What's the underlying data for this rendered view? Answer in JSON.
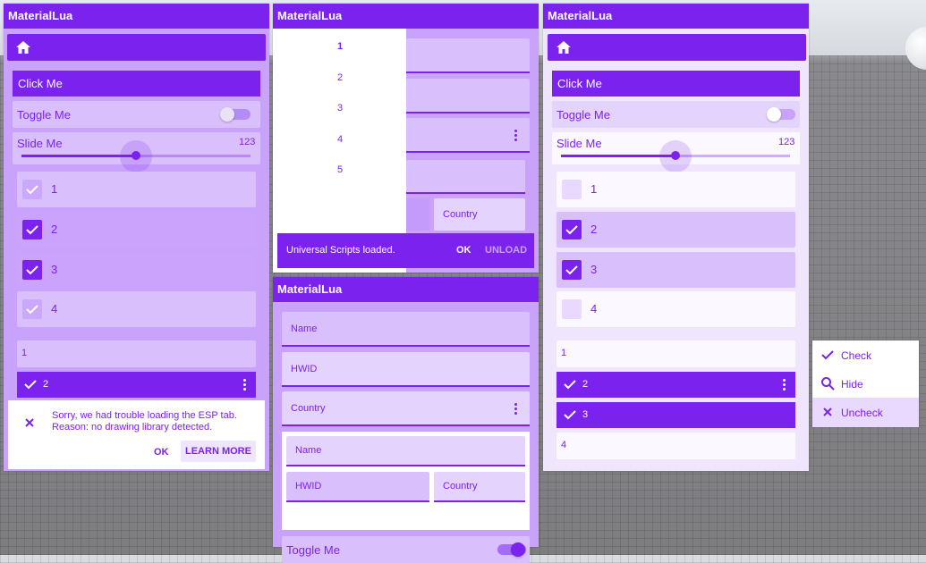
{
  "app": {
    "title": "MaterialLua"
  },
  "colors": {
    "accent": "#7b22ee",
    "panel": "#c9a2fb",
    "panel_light": "#efe6fd"
  },
  "win_left": {
    "title": "MaterialLua",
    "nav_icon": "home-icon",
    "button_label": "Click Me",
    "toggle_label": "Toggle Me",
    "slider_label": "Slide Me",
    "slider_value": "123",
    "checkboxes": [
      {
        "label": "1",
        "checked": true
      },
      {
        "label": "2",
        "checked": true
      },
      {
        "label": "3",
        "checked": true
      },
      {
        "label": "4",
        "checked": true
      }
    ],
    "list": [
      {
        "label": "1"
      },
      {
        "label": "2"
      }
    ],
    "dialog": {
      "message": "Sorry, we had trouble loading the ESP tab. Reason: no drawing library detected.",
      "ok_label": "OK",
      "learn_more_label": "LEARN MORE",
      "icon": "close-icon"
    }
  },
  "win_mid_top": {
    "title": "MaterialLua",
    "page_numbers": [
      "1",
      "2",
      "3",
      "4",
      "5"
    ],
    "country_label": "Country",
    "snackbar": {
      "message": "Universal Scripts loaded.",
      "ok_label": "OK",
      "unload_label": "UNLOAD"
    }
  },
  "win_mid_bottom": {
    "title": "MaterialLua",
    "fields": [
      {
        "label": "Name"
      },
      {
        "label": "HWID"
      },
      {
        "label": "Country"
      }
    ],
    "grid": {
      "name": "Name",
      "hwid": "HWID",
      "country": "Country"
    },
    "toggle_label": "Toggle Me"
  },
  "win_right": {
    "title": "MaterialLua",
    "nav_icon": "home-icon",
    "button_label": "Click Me",
    "toggle_label": "Toggle Me",
    "slider_label": "Slide Me",
    "slider_value": "123",
    "checkboxes": [
      {
        "label": "1",
        "checked": false
      },
      {
        "label": "2",
        "checked": true
      },
      {
        "label": "3",
        "checked": true
      },
      {
        "label": "4",
        "checked": false
      }
    ],
    "list": [
      {
        "label": "1"
      },
      {
        "label": "2"
      },
      {
        "label": "3"
      },
      {
        "label": "4"
      }
    ]
  },
  "context_menu": {
    "items": [
      {
        "label": "Check",
        "icon": "check-icon"
      },
      {
        "label": "Hide",
        "icon": "search-icon"
      },
      {
        "label": "Uncheck",
        "icon": "close-icon"
      }
    ]
  }
}
